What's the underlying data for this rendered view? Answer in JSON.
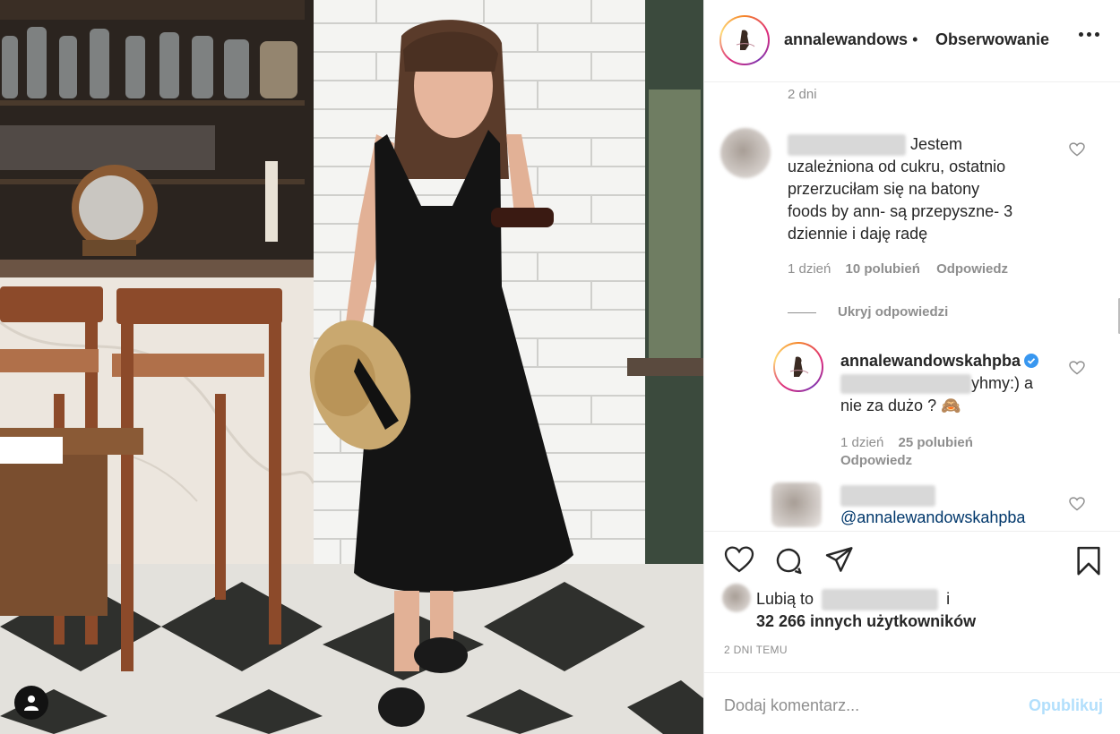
{
  "post": {
    "author": "annalewandows",
    "separator": "•",
    "follow_label": "Obserwowanie",
    "caption_time": "2 dni"
  },
  "comments": [
    {
      "text_lines": [
        "Jestem",
        "uzależniona od cukru, ostatnio",
        "przerzuciłam się na batony",
        "foods by ann- są przepyszne- 3",
        "dziennie i daję radę"
      ],
      "time": "1 dzień",
      "likes": "10 polubień",
      "reply_label": "Odpowiedz",
      "hide_replies_label": "Ukryj odpowiedzi",
      "replies": [
        {
          "username": "annalewandowskahpba",
          "text_line1": "yhmy:) a",
          "text_line2": "nie za dużo ?",
          "emoji": "🙈",
          "time": "1 dzień",
          "likes": "25 polubień",
          "reply_label": "Odpowiedz"
        }
      ]
    },
    {
      "mention": "@annalewandowskahpba"
    }
  ],
  "likes": {
    "prefix": "Lubią to",
    "conjunction": "i",
    "count_text": "32 266 innych użytkowników"
  },
  "timestamp": "2 DNI TEMU",
  "add_comment": {
    "placeholder": "Dodaj komentarz...",
    "publish_label": "Opublikuj"
  },
  "icons": {
    "more": "more-horizontal-icon",
    "like": "heart-outline-icon",
    "comment": "comment-bubble-icon",
    "share": "paper-plane-icon",
    "save": "bookmark-icon",
    "tag": "user-tag-icon",
    "verified": "verified-badge-icon"
  },
  "colors": {
    "text": "#262626",
    "muted": "#8e8e8e",
    "publish_disabled": "#b2dffc",
    "verified": "#3897f0",
    "border": "#efefef"
  }
}
